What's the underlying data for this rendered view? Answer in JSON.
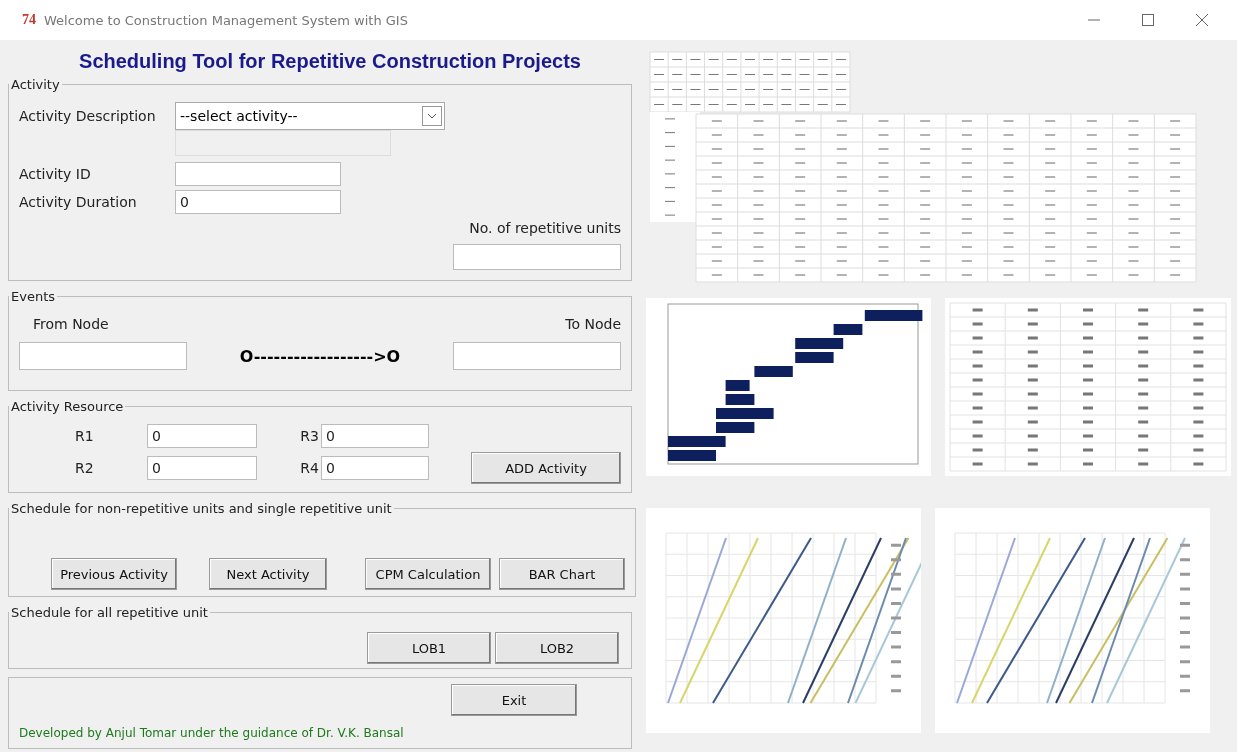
{
  "window": {
    "icon_text": "74",
    "title": "Welcome to Construction Management System with GIS"
  },
  "heading": "Scheduling Tool for Repetitive Construction Projects",
  "activity": {
    "title": "Activity",
    "description_label": "Activity Description",
    "description_value": "--select activity--",
    "id_label": "Activity ID",
    "duration_label": "Activity Duration",
    "duration_value": "0",
    "units_label": "No. of repetitive units"
  },
  "events": {
    "title": "Events",
    "from_label": "From Node",
    "to_label": "To Node",
    "arrow": "O------------------>O"
  },
  "resource": {
    "title": "Activity Resource",
    "fields": [
      {
        "label": "R1",
        "value": "0"
      },
      {
        "label": "R3",
        "value": "0"
      },
      {
        "label": "R2",
        "value": "0"
      },
      {
        "label": "R4",
        "value": "0"
      }
    ],
    "button": "ADD Activity"
  },
  "single_schedule": {
    "title": "Schedule for non-repetitive units and single repetitive unit",
    "buttons": [
      "Previous Activity",
      "Next Activity",
      "CPM Calculation",
      "BAR Chart"
    ]
  },
  "all_schedule": {
    "title": "Schedule for all repetitive unit",
    "buttons": [
      "LOB1",
      "LOB2"
    ]
  },
  "footer": {
    "button": "Exit",
    "credit": "Developed by Anjul Tomar under the guidance of Dr. V.K. Bansal"
  }
}
